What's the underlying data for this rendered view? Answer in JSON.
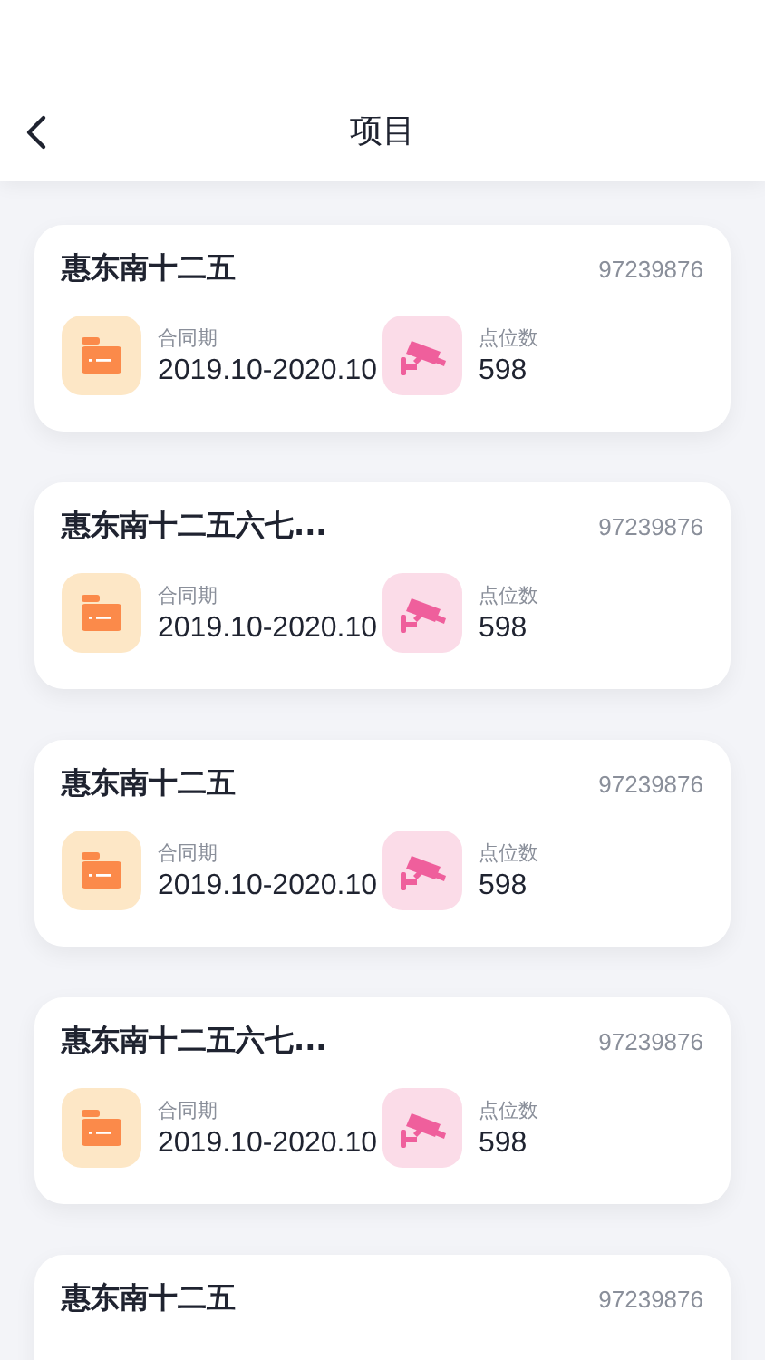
{
  "header": {
    "title": "项目"
  },
  "projects": [
    {
      "name": "惠东南十二五",
      "code": "97239876",
      "contract_label": "合同期",
      "contract_value": "2019.10-2020.10",
      "points_label": "点位数",
      "points_value": "598"
    },
    {
      "name": "惠东南十二五六七...",
      "code": "97239876",
      "contract_label": "合同期",
      "contract_value": "2019.10-2020.10",
      "points_label": "点位数",
      "points_value": "598"
    },
    {
      "name": "惠东南十二五",
      "code": "97239876",
      "contract_label": "合同期",
      "contract_value": "2019.10-2020.10",
      "points_label": "点位数",
      "points_value": "598"
    },
    {
      "name": "惠东南十二五六七...",
      "code": "97239876",
      "contract_label": "合同期",
      "contract_value": "2019.10-2020.10",
      "points_label": "点位数",
      "points_value": "598"
    },
    {
      "name": "惠东南十二五",
      "code": "97239876"
    }
  ]
}
